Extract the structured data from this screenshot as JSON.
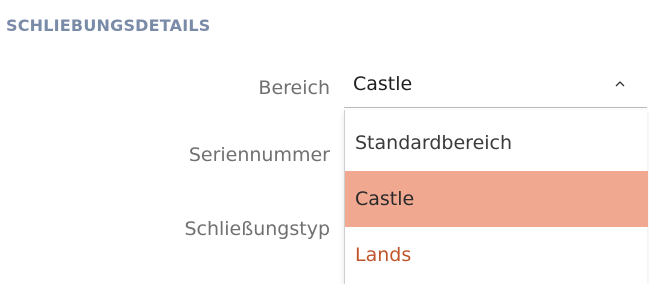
{
  "section": {
    "title": "SCHLIEBUNGSDETAILS"
  },
  "fields": {
    "bereich_label": "Bereich",
    "seriennummer_label": "Seriennummer",
    "schliessungstyp_label": "Schließungstyp"
  },
  "bereich_select": {
    "value": "Castle",
    "expanded": true,
    "options": [
      "Standardbereich",
      "Castle",
      "Lands"
    ],
    "selected_index": 1
  },
  "colors": {
    "section_title": "#7a8ba8",
    "selected_option_bg": "#f0a891",
    "highlight_text": "#c0552b"
  },
  "icons": {
    "dropdown_toggle": "chevron-up-icon"
  }
}
